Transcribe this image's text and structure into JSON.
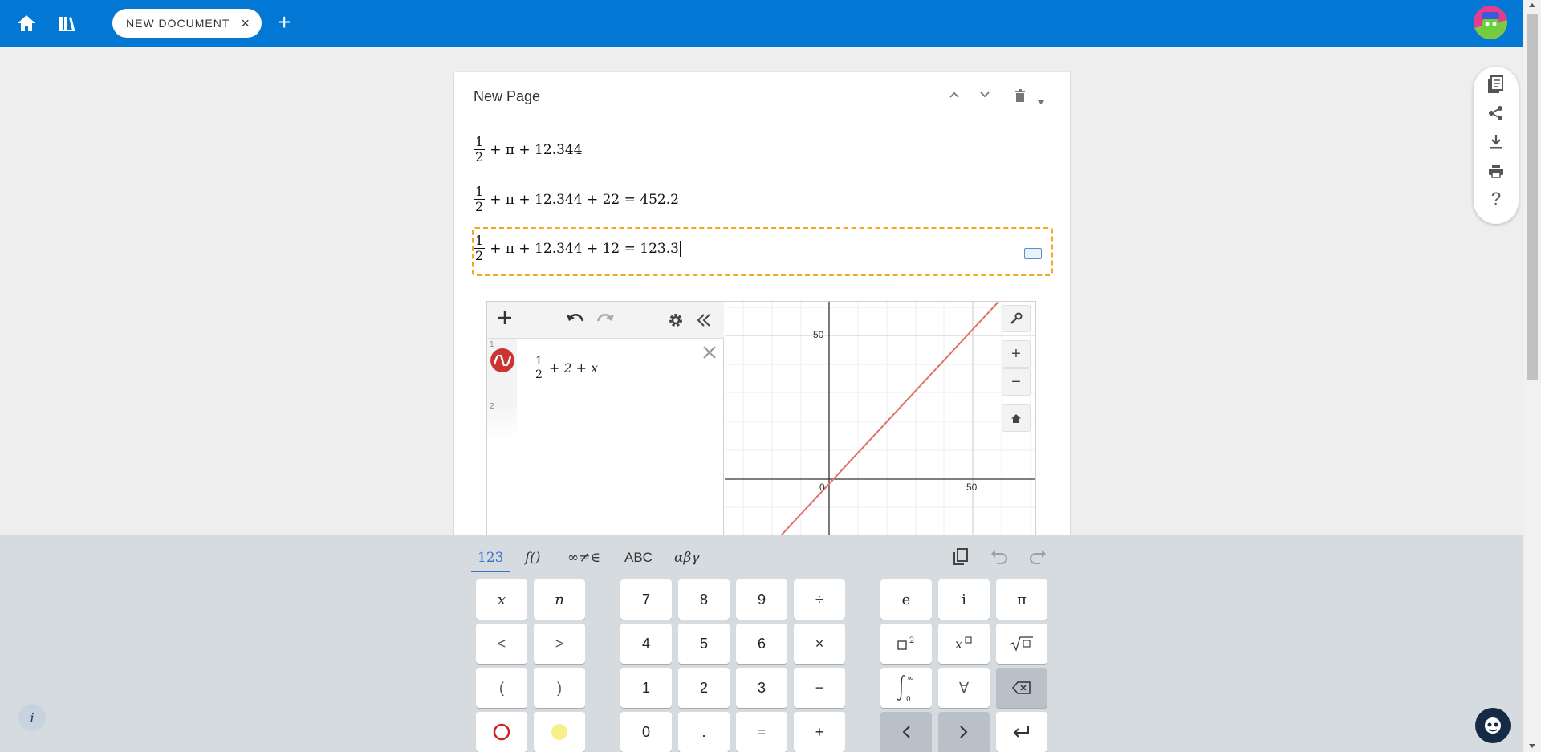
{
  "topbar": {
    "home_icon": "home-icon",
    "library_icon": "library-icon",
    "tab_label": "NEW DOCUMENT",
    "tab_close": "×",
    "add_tab": "+"
  },
  "page": {
    "title": "New Page",
    "lines": [
      {
        "num": "1",
        "den": "2",
        "expr": "+ π + 12.344"
      },
      {
        "num": "1",
        "den": "2",
        "expr": "+ π + 12.344 + 22 = 452.2"
      },
      {
        "num": "1",
        "den": "2",
        "expr": "+ π + 12.344 + 12 = 123.3"
      }
    ]
  },
  "ggb": {
    "rows": [
      {
        "index": "1",
        "num": "1",
        "den": "2",
        "expr": "+ 2 + x"
      },
      {
        "index": "2"
      }
    ],
    "axis_ticks": {
      "x_zero": "0",
      "x_fifty": "50",
      "y_fifty": "50"
    },
    "plus": "+",
    "minus": "−"
  },
  "side": {
    "help": "?"
  },
  "keyboard": {
    "tabs": [
      "123",
      "f()",
      "∞≠∈",
      "ABC",
      "αβγ"
    ],
    "active_tab": "123",
    "left_keys": [
      "x",
      "n",
      "<",
      ">",
      "(",
      ")"
    ],
    "num_keys": [
      "7",
      "8",
      "9",
      "÷",
      "4",
      "5",
      "6",
      "×",
      "1",
      "2",
      "3",
      "−",
      "0",
      ".",
      "=",
      "+"
    ],
    "right_keys": [
      "e",
      "i",
      "π",
      "∀"
    ],
    "info": "i"
  },
  "colors": {
    "topbar": "#0277d4",
    "active_border": "#f5a623",
    "graph_line": "#e0706a"
  }
}
